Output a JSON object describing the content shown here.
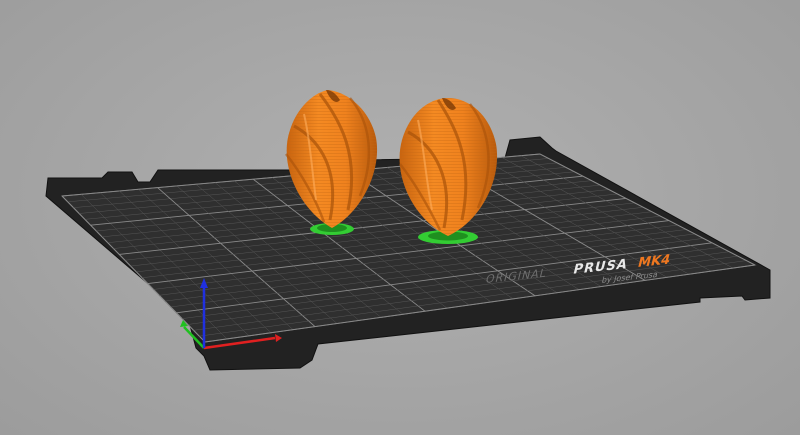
{
  "viewport": {
    "name": "3D print bed viewport"
  },
  "bed": {
    "logo": {
      "prefix": "ORIGINAL",
      "brand": "PRUSA",
      "model": "MK4",
      "byline": "by Josef Prusa"
    }
  },
  "colors": {
    "background": "#a3a3a3",
    "bed_surface": "#2e2e2e",
    "bed_edge": "#1c1c1c",
    "grid_minor": "#555555",
    "grid_major": "#8a8a8a",
    "model": "#f0821e",
    "model_shadow": "#b65a0c",
    "brim": "#33cc33",
    "axis_x": "#e02020",
    "axis_y": "#20c020",
    "axis_z": "#2020e0",
    "logo_brand": "#e8e8e8",
    "logo_model": "#f07820"
  },
  "objects": [
    {
      "name": "twisted-vase-left",
      "selected": false
    },
    {
      "name": "twisted-vase-right",
      "selected": false
    }
  ]
}
